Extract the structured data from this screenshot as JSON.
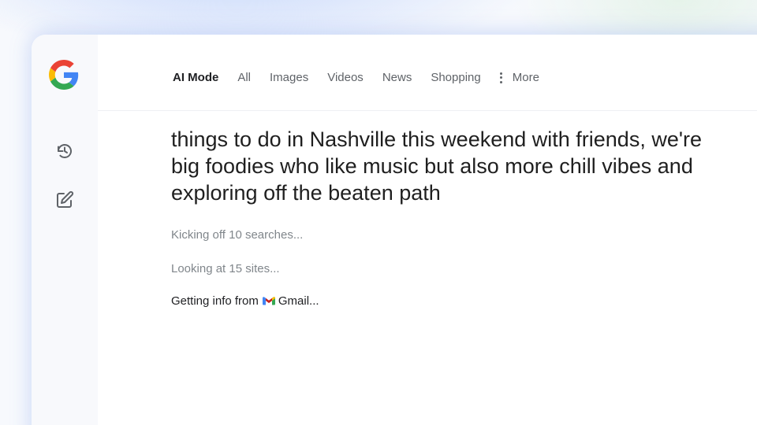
{
  "nav": {
    "logo": "G",
    "rail": [
      {
        "icon": "history-icon"
      },
      {
        "icon": "new-chat-icon"
      }
    ],
    "tabs": [
      {
        "label": "AI Mode"
      },
      {
        "label": "All"
      },
      {
        "label": "Images"
      },
      {
        "label": "Videos"
      },
      {
        "label": "News"
      },
      {
        "label": "Shopping"
      }
    ],
    "more_label": "More"
  },
  "query": {
    "text": "things to do in Nashville this weekend with friends, we're big foodies who like music but also more chill vibes and exploring off the beaten path"
  },
  "status": [
    {
      "lead": "Kicking off",
      "detail": "10 searches..."
    },
    {
      "lead": "Looking at",
      "detail": "15 sites..."
    },
    {
      "lead": "Getting info",
      "from": "from",
      "icon": "gmail-icon",
      "detail": "Gmail..."
    }
  ],
  "colors": {
    "google_blue": "#4285F4",
    "google_red": "#EA4335",
    "google_yellow": "#FBBC05",
    "google_green": "#34A853"
  }
}
